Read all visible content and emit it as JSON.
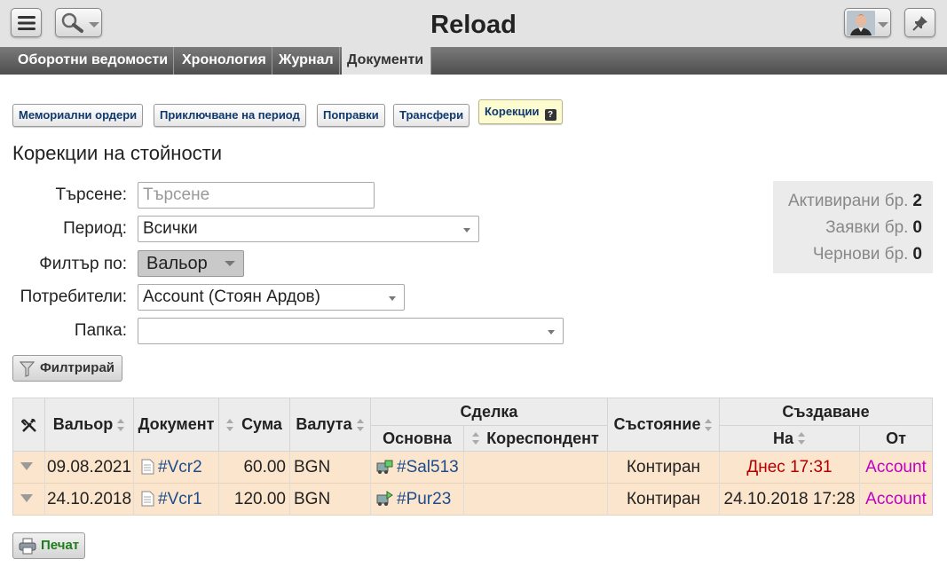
{
  "header": {
    "title": "Reload"
  },
  "tabs": [
    {
      "label": "Оборотни ведомости",
      "active": false
    },
    {
      "label": "Хронология",
      "active": false
    },
    {
      "label": "Журнал",
      "active": false
    },
    {
      "label": "Документи",
      "active": true
    }
  ],
  "subtabs": [
    {
      "label": "Мемориални ордери"
    },
    {
      "label": "Приключване на период"
    },
    {
      "label": "Поправки"
    },
    {
      "label": "Трансфери"
    },
    {
      "label": "Корекции",
      "active": true,
      "help": "?"
    }
  ],
  "page_title": "Корекции на стойности",
  "form": {
    "search": {
      "label": "Търсене:",
      "placeholder": "Търсене"
    },
    "period": {
      "label": "Период:",
      "value": "Всички"
    },
    "filter_by": {
      "label": "Филтър по:",
      "value": "Вальор"
    },
    "users": {
      "label": "Потребители:",
      "value": "Account (Стоян Ардов)"
    },
    "folder": {
      "label": "Папка:",
      "value": ""
    },
    "filter_button": "Филтрирай"
  },
  "stats": [
    {
      "label": "Активирани бр.",
      "value": "2"
    },
    {
      "label": "Заявки бр.",
      "value": "0"
    },
    {
      "label": "Чернови бр.",
      "value": "0"
    }
  ],
  "table": {
    "headers": {
      "valor": "Вальор",
      "document": "Документ",
      "amount": "Сума",
      "currency": "Валута",
      "deal": "Сделка",
      "deal_main": "Основна",
      "deal_corr": "Кореспондент",
      "state": "Състояние",
      "created": "Създаване",
      "created_on": "На",
      "created_by": "От"
    },
    "rows": [
      {
        "valor": "09.08.2021",
        "document": "#Vcr2",
        "amount": "60.00",
        "currency": "BGN",
        "deal_main": "#Sal513",
        "deal_corr": "",
        "state": "Контиран",
        "created_on": "Днес 17:31",
        "created_by": "Account"
      },
      {
        "valor": "24.10.2018",
        "document": "#Vcr1",
        "amount": "120.00",
        "currency": "BGN",
        "deal_main": "#Pur23",
        "deal_corr": "",
        "state": "Контиран",
        "created_on": "24.10.2018 17:28",
        "created_by": "Account"
      }
    ]
  },
  "print_button": "Печат",
  "colors": {
    "row_bg": "#fbe5cc",
    "link": "#1c4d8c",
    "today": "#b20000",
    "user": "#c000c0",
    "print": "#1b7d1b"
  }
}
